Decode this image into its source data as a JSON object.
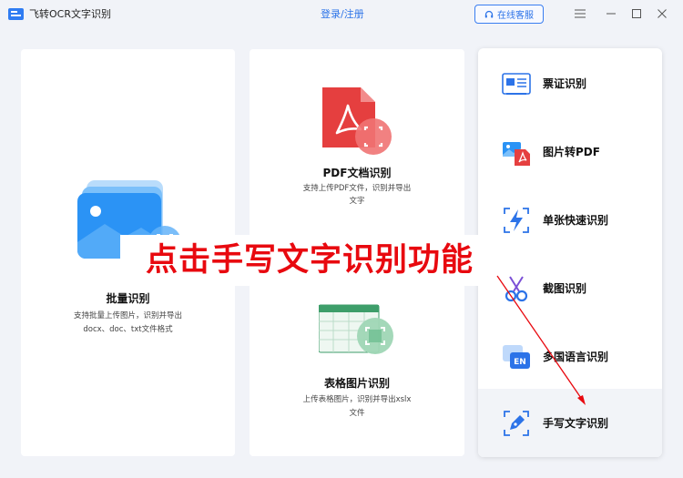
{
  "app": {
    "title": "飞转OCR文字识别",
    "login_label": "登录/注册",
    "service_label": "在线客服"
  },
  "window_controls": [
    "menu-icon",
    "minimize-icon",
    "maximize-icon",
    "close-icon"
  ],
  "cards": {
    "batch": {
      "title": "批量识别",
      "desc_line1": "支持批量上传图片，识别并导出",
      "desc_line2": "docx、doc、txt文件格式"
    },
    "pdf": {
      "title": "PDF文档识别",
      "desc_line1": "支持上传PDF文件，识别并导出",
      "desc_line2": "文字"
    },
    "table": {
      "title": "表格图片识别",
      "desc_line1": "上传表格图片，识别并导出xslx",
      "desc_line2": "文件"
    }
  },
  "side_items": [
    {
      "label": "票证识别",
      "icon": "id-card-icon"
    },
    {
      "label": "图片转PDF",
      "icon": "image-to-pdf-icon"
    },
    {
      "label": "单张快速识别",
      "icon": "lightning-icon"
    },
    {
      "label": "截图识别",
      "icon": "scissors-icon"
    },
    {
      "label": "多国语言识别",
      "icon": "language-en-icon"
    },
    {
      "label": "手写文字识别",
      "icon": "pen-icon"
    }
  ],
  "annotation": {
    "text": "点击手写文字识别功能"
  },
  "colors": {
    "accent": "#2c73e8",
    "annotation": "#e8090f",
    "pdf_red": "#e53f3f",
    "table_green": "#3e9e6a"
  }
}
